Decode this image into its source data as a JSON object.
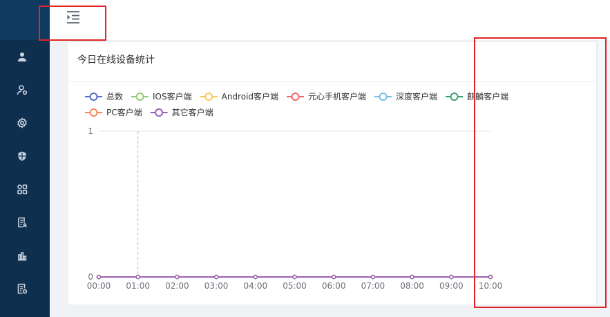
{
  "sidebar": {
    "items": [
      {
        "icon": "user-icon"
      },
      {
        "icon": "user-settings-icon"
      },
      {
        "icon": "gear-icon"
      },
      {
        "icon": "shield-icon"
      },
      {
        "icon": "apps-icon"
      },
      {
        "icon": "report-icon"
      },
      {
        "icon": "bar-chart-icon"
      },
      {
        "icon": "log-icon"
      }
    ]
  },
  "header": {
    "toggle_icon": "menu-fold-icon"
  },
  "card": {
    "title": "今日在线设备统计"
  },
  "colors": {
    "sidebar": "#0f2f4e",
    "annotation": "#e02424"
  },
  "chart_data": {
    "type": "line",
    "x": [
      "00:00",
      "01:00",
      "02:00",
      "03:00",
      "04:00",
      "05:00",
      "06:00",
      "07:00",
      "08:00",
      "09:00",
      "10:00"
    ],
    "ylim": [
      0,
      1
    ],
    "yticks": [
      "0",
      "1"
    ],
    "series": [
      {
        "name": "总数",
        "color": "#5470c6",
        "values": [
          0,
          0,
          0,
          0,
          0,
          0,
          0,
          0,
          0,
          0,
          0
        ]
      },
      {
        "name": "IOS客户端",
        "color": "#91cc75",
        "values": [
          0,
          0,
          0,
          0,
          0,
          0,
          0,
          0,
          0,
          0,
          0
        ]
      },
      {
        "name": "Android客户端",
        "color": "#fac858",
        "values": [
          0,
          0,
          0,
          0,
          0,
          0,
          0,
          0,
          0,
          0,
          0
        ]
      },
      {
        "name": "元心手机客户端",
        "color": "#ee6666",
        "values": [
          0,
          0,
          0,
          0,
          0,
          0,
          0,
          0,
          0,
          0,
          0
        ]
      },
      {
        "name": "深度客户端",
        "color": "#73c0de",
        "values": [
          0,
          0,
          0,
          0,
          0,
          0,
          0,
          0,
          0,
          0,
          0
        ]
      },
      {
        "name": "麒麟客户端",
        "color": "#3ba272",
        "values": [
          0,
          0,
          0,
          0,
          0,
          0,
          0,
          0,
          0,
          0,
          0
        ]
      },
      {
        "name": "PC客户端",
        "color": "#fc8452",
        "values": [
          0,
          0,
          0,
          0,
          0,
          0,
          0,
          0,
          0,
          0,
          0
        ]
      },
      {
        "name": "其它客户端",
        "color": "#9a60b4",
        "values": [
          0,
          0,
          0,
          0,
          0,
          0,
          0,
          0,
          0,
          0,
          0
        ]
      }
    ],
    "legend_position": "top-left"
  }
}
